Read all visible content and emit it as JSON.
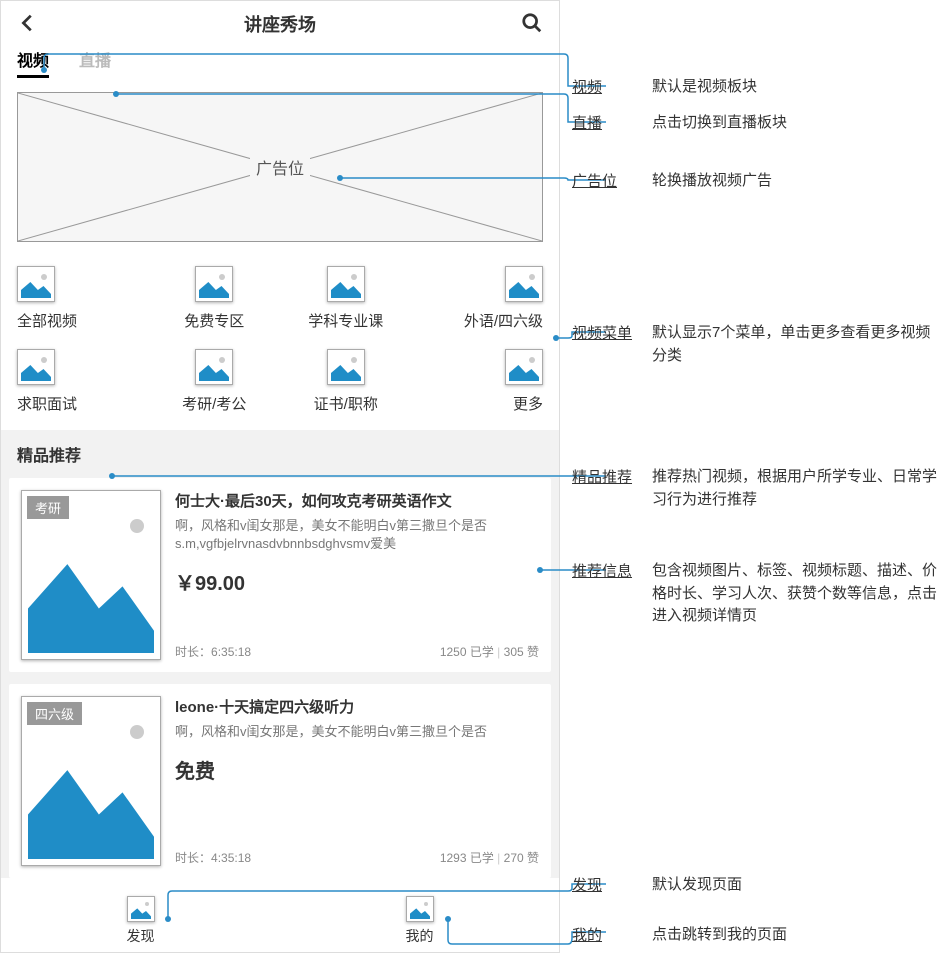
{
  "header": {
    "title": "讲座秀场"
  },
  "tabs": [
    {
      "label": "视频",
      "active": true
    },
    {
      "label": "直播",
      "active": false
    }
  ],
  "banner": {
    "label": "广告位"
  },
  "categories": [
    {
      "label": "全部视频"
    },
    {
      "label": "免费专区"
    },
    {
      "label": "学科专业课"
    },
    {
      "label": "外语/四六级"
    },
    {
      "label": "求职面试"
    },
    {
      "label": "考研/考公"
    },
    {
      "label": "证书/职称"
    },
    {
      "label": "更多"
    }
  ],
  "section": {
    "title": "精品推荐",
    "cards": [
      {
        "tag": "考研",
        "title": "何士大·最后30天，如何攻克考研英语作文",
        "desc": "啊，风格和v闺女那是，美女不能明白v第三撒旦个是否s.m,vgfbjelrvnasdvbnnbsdghvsmv爱美",
        "price": "￥99.00",
        "duration_label": "时长：",
        "duration": "6:35:18",
        "learned": "1250 已学",
        "likes": "305 赞"
      },
      {
        "tag": "四六级",
        "title": "leone·十天搞定四六级听力",
        "desc": "啊，风格和v闺女那是，美女不能明白v第三撒旦个是否",
        "price": "免费",
        "duration_label": "时长：",
        "duration": "4:35:18",
        "learned": "1293 已学",
        "likes": "270 赞"
      }
    ]
  },
  "bottom": [
    {
      "label": "发现"
    },
    {
      "label": "我的"
    }
  ],
  "annotations": [
    {
      "label": "视频",
      "desc": "默认是视频板块"
    },
    {
      "label": "直播",
      "desc": "点击切换到直播板块"
    },
    {
      "label": "广告位",
      "desc": "轮换播放视频广告"
    },
    {
      "label": "视频菜单",
      "desc": "默认显示7个菜单，单击更多查看更多视频分类"
    },
    {
      "label": "精品推荐",
      "desc": "推荐热门视频，根据用户所学专业、日常学习行为进行推荐"
    },
    {
      "label": "推荐信息",
      "desc": "包含视频图片、标签、视频标题、描述、价格时长、学习人次、获赞个数等信息，点击进入视频详情页"
    },
    {
      "label": "发现",
      "desc": "默认发现页面"
    },
    {
      "label": "我的",
      "desc": "点击跳转到我的页面"
    }
  ]
}
